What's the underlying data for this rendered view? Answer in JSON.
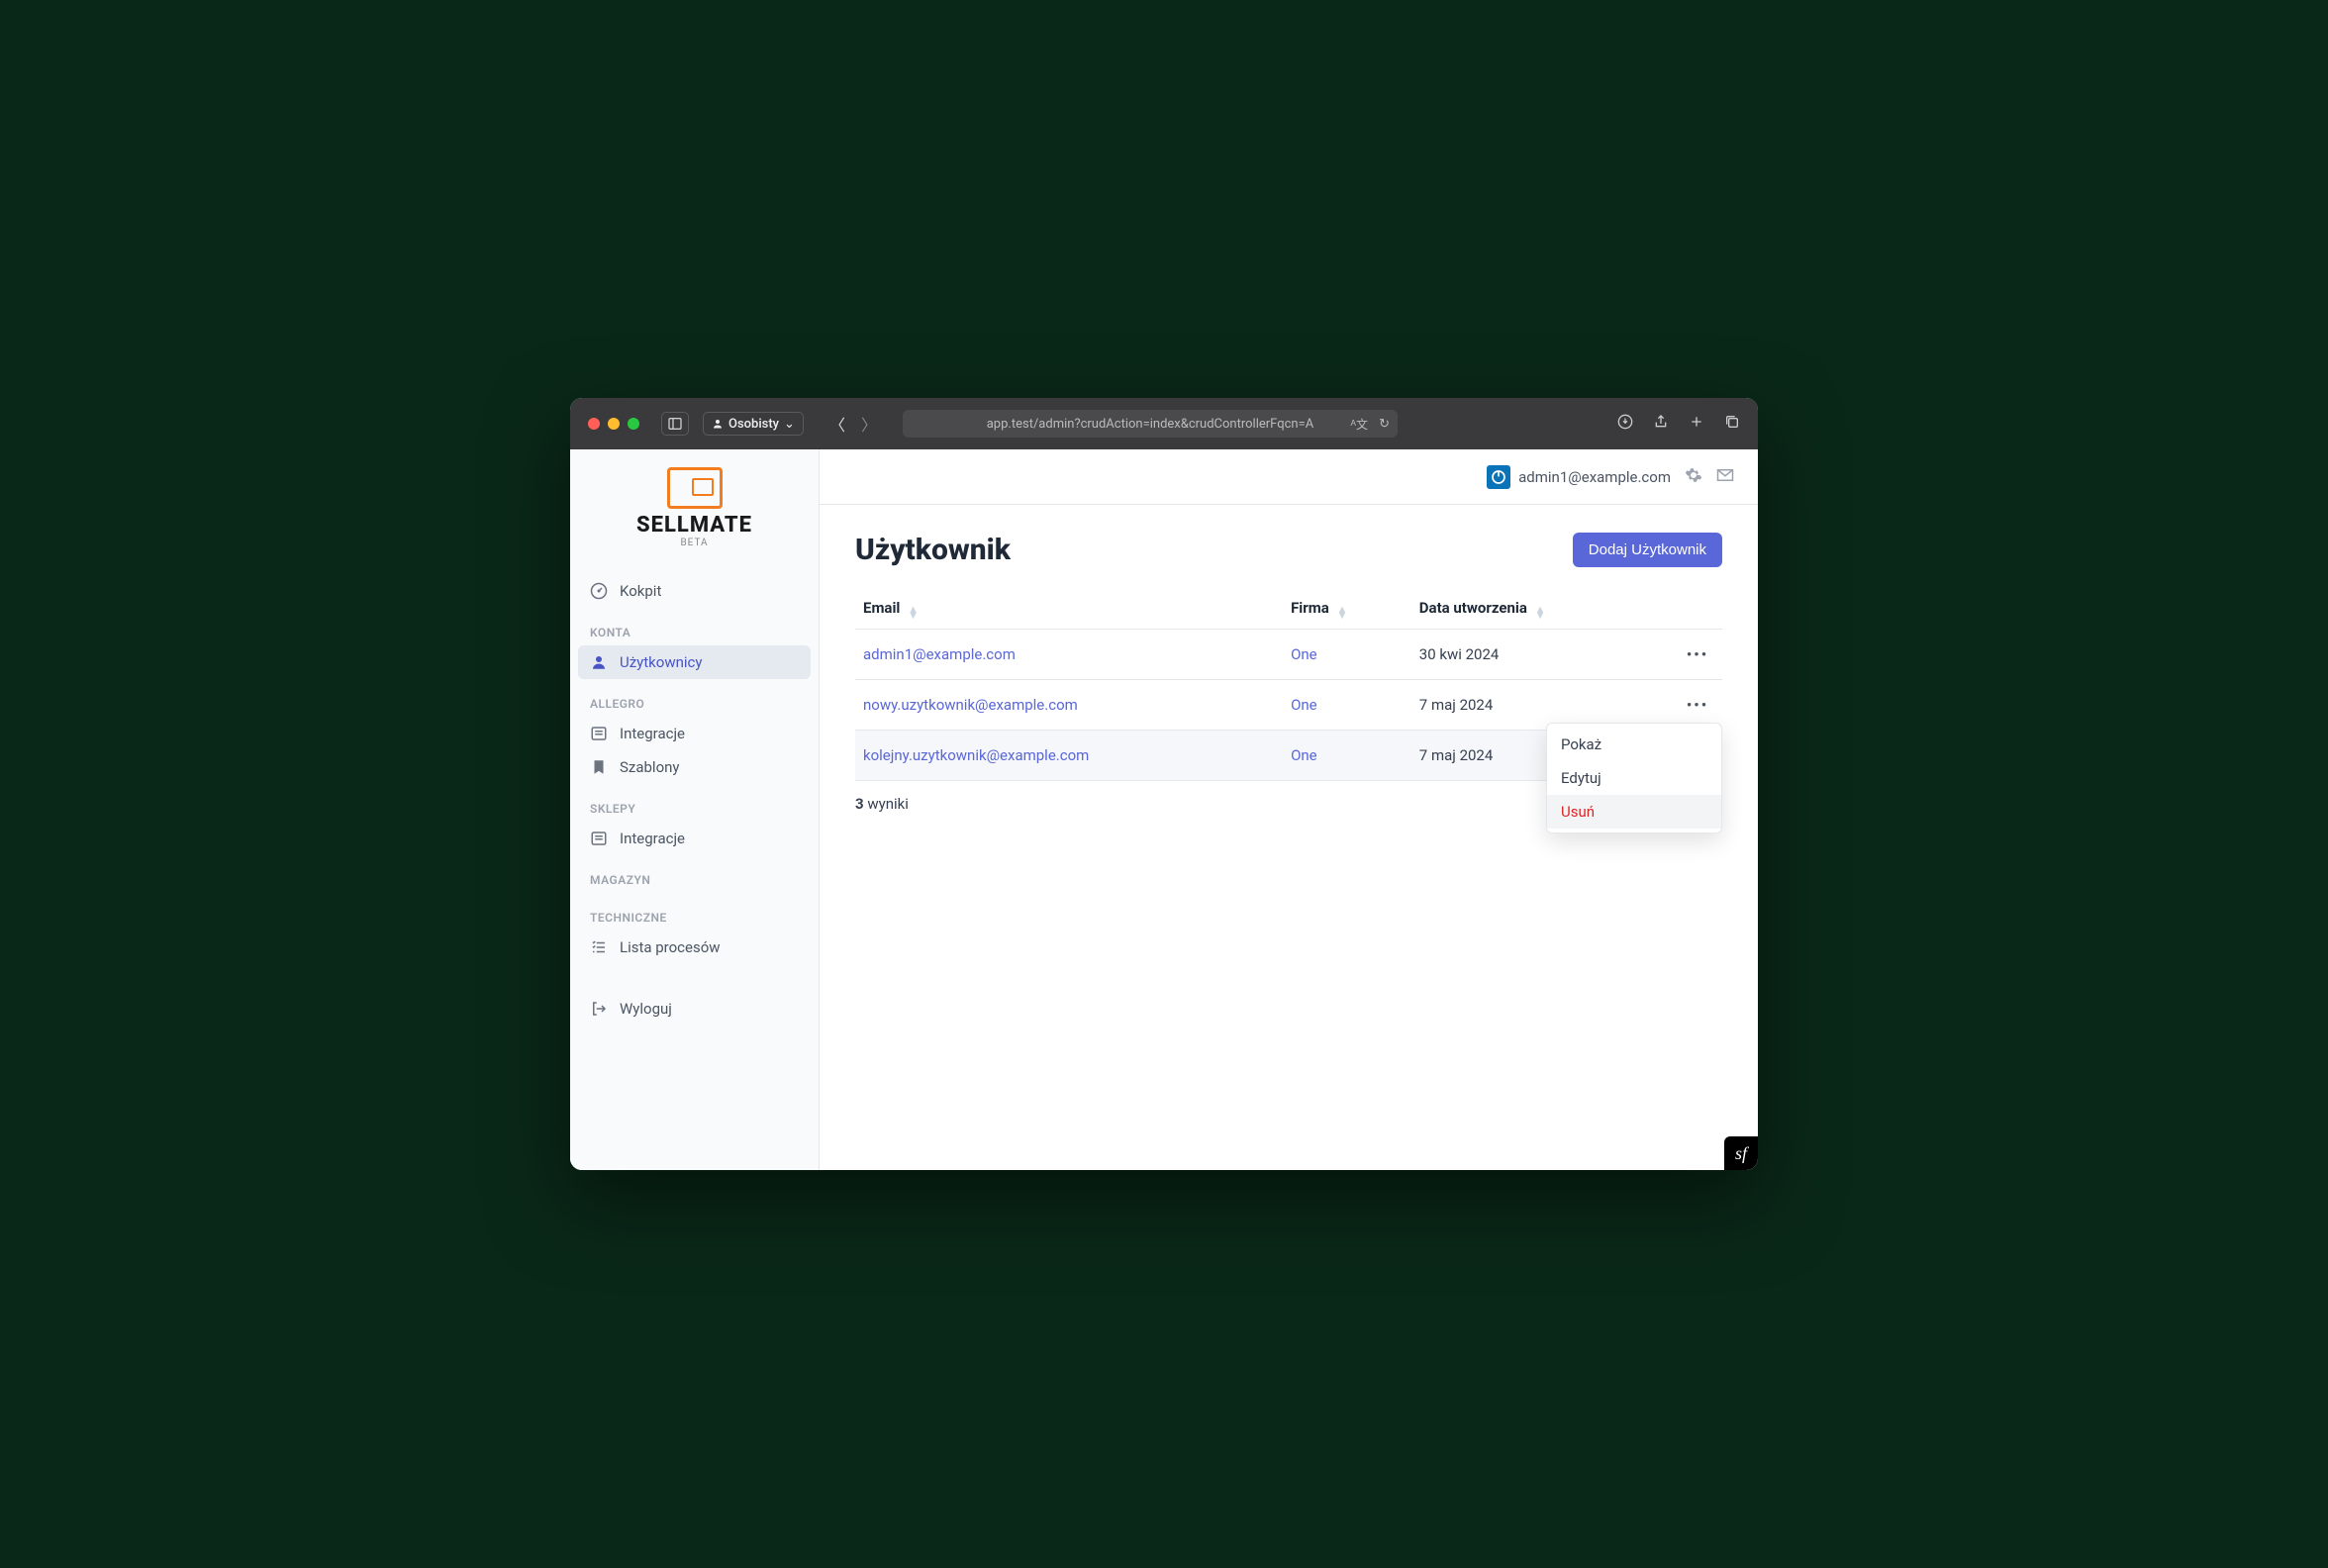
{
  "browser": {
    "profile": "Osobisty",
    "url": "app.test/admin?crudAction=index&crudControllerFqcn=A"
  },
  "brand": {
    "name": "SELLMATE",
    "sub": "BETA"
  },
  "sidebar": {
    "items": {
      "dashboard": "Kokpit",
      "users": "Użytkownicy",
      "integrations_allegro": "Integracje",
      "templates": "Szablony",
      "integrations_shops": "Integracje",
      "processes": "Lista procesów",
      "logout": "Wyloguj"
    },
    "sections": {
      "accounts": "KONTA",
      "allegro": "ALLEGRO",
      "shops": "SKLEPY",
      "warehouse": "MAGAZYN",
      "technical": "TECHNICZNE"
    }
  },
  "header": {
    "user_email": "admin1@example.com"
  },
  "page": {
    "title": "Użytkownik",
    "add_button": "Dodaj Użytkownik"
  },
  "table": {
    "headers": {
      "email": "Email",
      "company": "Firma",
      "created": "Data utworzenia"
    },
    "rows": [
      {
        "email": "admin1@example.com",
        "company": "One",
        "created": "30 kwi 2024"
      },
      {
        "email": "nowy.uzytkownik@example.com",
        "company": "One",
        "created": "7 maj 2024"
      },
      {
        "email": "kolejny.uzytkownik@example.com",
        "company": "One",
        "created": "7 maj 2024"
      }
    ],
    "results_count": "3",
    "results_label": "wyniki"
  },
  "dropdown": {
    "show": "Pokaż",
    "edit": "Edytuj",
    "delete": "Usuń"
  }
}
